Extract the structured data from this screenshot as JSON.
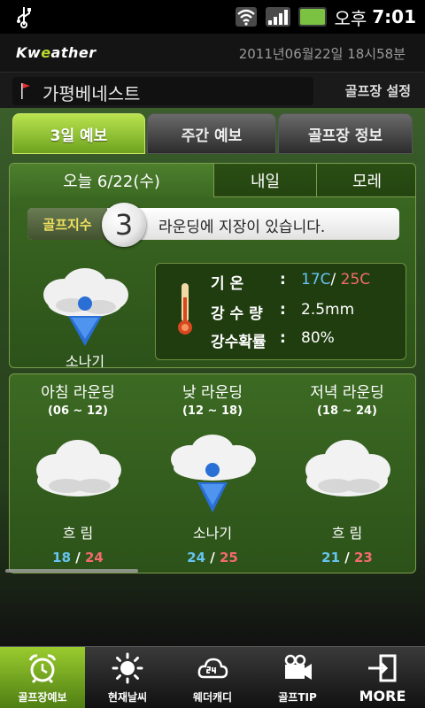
{
  "status_bar": {
    "time": "7:01",
    "ampm": "오후",
    "icons": [
      "usb-icon",
      "wifi-icon",
      "signal-icon",
      "battery-icon"
    ]
  },
  "header": {
    "logo_pre": "Kw",
    "logo_o": "e",
    "logo_post": "ather",
    "datetime": "2011년06월22일 18시58분"
  },
  "course": {
    "name": "가평베네스트",
    "setting_label": "골프장 설정"
  },
  "tabs": [
    {
      "label": "3일 예보",
      "active": true
    },
    {
      "label": "주간 예보",
      "active": false
    },
    {
      "label": "골프장 정보",
      "active": false
    }
  ],
  "day_tabs": [
    {
      "label": "오늘 6/22(수)",
      "active": true
    },
    {
      "label": "내일",
      "active": false
    },
    {
      "label": "모레",
      "active": false
    }
  ],
  "golf_index": {
    "label": "골프지수",
    "value": "3",
    "message": "라운딩에 지장이 있습니다."
  },
  "today": {
    "weather": "소나기",
    "icon": "cloud-shower-icon",
    "temp_label": "기    온",
    "temp_low": "17",
    "temp_sep": "/",
    "temp_high": "25",
    "temp_unit": "C",
    "rain_label": "강 수 량",
    "rain_value": "2.5mm",
    "prob_label": "강수확률",
    "prob_value": "80%",
    "colon": ":"
  },
  "rounds": [
    {
      "title": "아침 라운딩",
      "hours": "(06 ~ 12)",
      "weather": "흐 림",
      "icon": "cloud-icon",
      "low": "18",
      "high": "24"
    },
    {
      "title": "낮 라운딩",
      "hours": "(12 ~ 18)",
      "weather": "소나기",
      "icon": "cloud-shower-icon",
      "low": "24",
      "high": "25"
    },
    {
      "title": "저녁 라운딩",
      "hours": "(18 ~ 24)",
      "weather": "흐 림",
      "icon": "cloud-icon",
      "low": "21",
      "high": "23"
    }
  ],
  "temp_slash": "/",
  "bottom_nav": [
    {
      "label": "골프장예보",
      "icon": "alarm-clock-icon",
      "active": true
    },
    {
      "label": "현재날씨",
      "icon": "sun-icon",
      "active": false
    },
    {
      "label": "웨더캐디",
      "icon": "cloud-24-icon",
      "active": false
    },
    {
      "label": "골프TIP",
      "icon": "film-icon",
      "active": false
    },
    {
      "label": "MORE",
      "icon": "exit-icon",
      "active": false
    }
  ],
  "colors": {
    "accent": "#9acc2e",
    "temp_low": "#66c4f2",
    "temp_high": "#f36b6b",
    "golf_index_label": "#f0e060"
  }
}
